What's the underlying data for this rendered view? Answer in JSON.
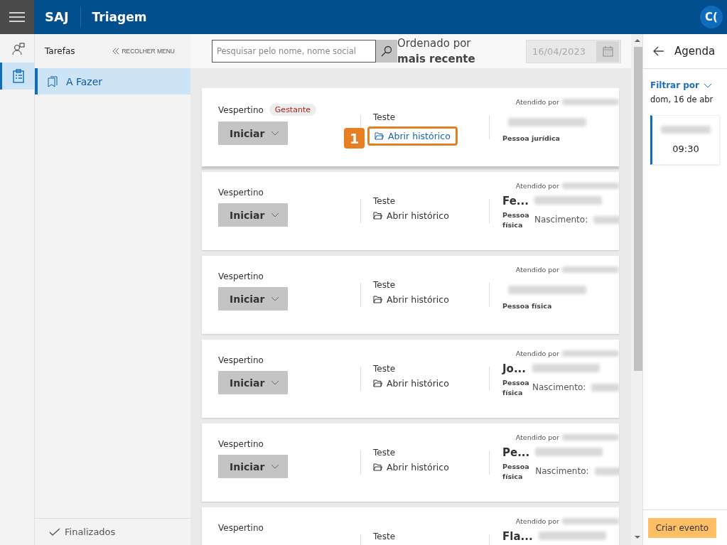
{
  "header": {
    "brand": "SAJ",
    "title": "Triagem",
    "avatar": "C("
  },
  "rail": [
    {
      "kind": "person",
      "selected": false
    },
    {
      "kind": "clipboard",
      "selected": true
    }
  ],
  "sidebar": {
    "title": "Tarefas",
    "collapse": "RECOLHER MENU",
    "items": [
      {
        "label": "A Fazer",
        "selected": true
      }
    ],
    "footer": "Finalizados"
  },
  "toolbar": {
    "search": {
      "placeholder": "Pesquisar pelo nome, nome social"
    },
    "sort_label": "Ordenado por",
    "sort_value": "mais recente",
    "date": "16/04/2023"
  },
  "cards": [
    {
      "shift": "Vespertino",
      "tag": "Gestante",
      "action": "Iniciar",
      "service": "Teste",
      "link": "Abrir histórico",
      "callout": "1",
      "attended": "Atendido por",
      "person_type": "Pessoa jurídica"
    },
    {
      "shift": "Vespertino",
      "action": "Iniciar",
      "service": "Teste",
      "link": "Abrir histórico",
      "attended": "Atendido por",
      "name": "Fe...",
      "person_type": "Pessoa física",
      "birth": "Nascimento:"
    },
    {
      "shift": "Vespertino",
      "action": "Iniciar",
      "service": "Teste",
      "link": "Abrir histórico",
      "attended": "Atendido por",
      "person_type": "Pessoa física"
    },
    {
      "shift": "Vespertino",
      "action": "Iniciar",
      "service": "Teste",
      "link": "Abrir histórico",
      "attended": "Atendido por",
      "name": "Jo...",
      "person_type": "Pessoa física",
      "birth": "Nascimento:"
    },
    {
      "shift": "Vespertino",
      "action": "Iniciar",
      "service": "Teste",
      "link": "Abrir histórico",
      "attended": "Atendido por",
      "name": "Pe...",
      "person_type": "Pessoa física",
      "birth": "Nascimento:"
    },
    {
      "shift": "Vespertino",
      "service": "Teste",
      "attended": "Atendido por",
      "name": "Fla..."
    }
  ],
  "agenda": {
    "title": "Agenda",
    "filter": "Filtrar por",
    "date": "dom, 16 de abr",
    "events": [
      {
        "time": "09:30"
      }
    ],
    "create": "Criar evento"
  }
}
